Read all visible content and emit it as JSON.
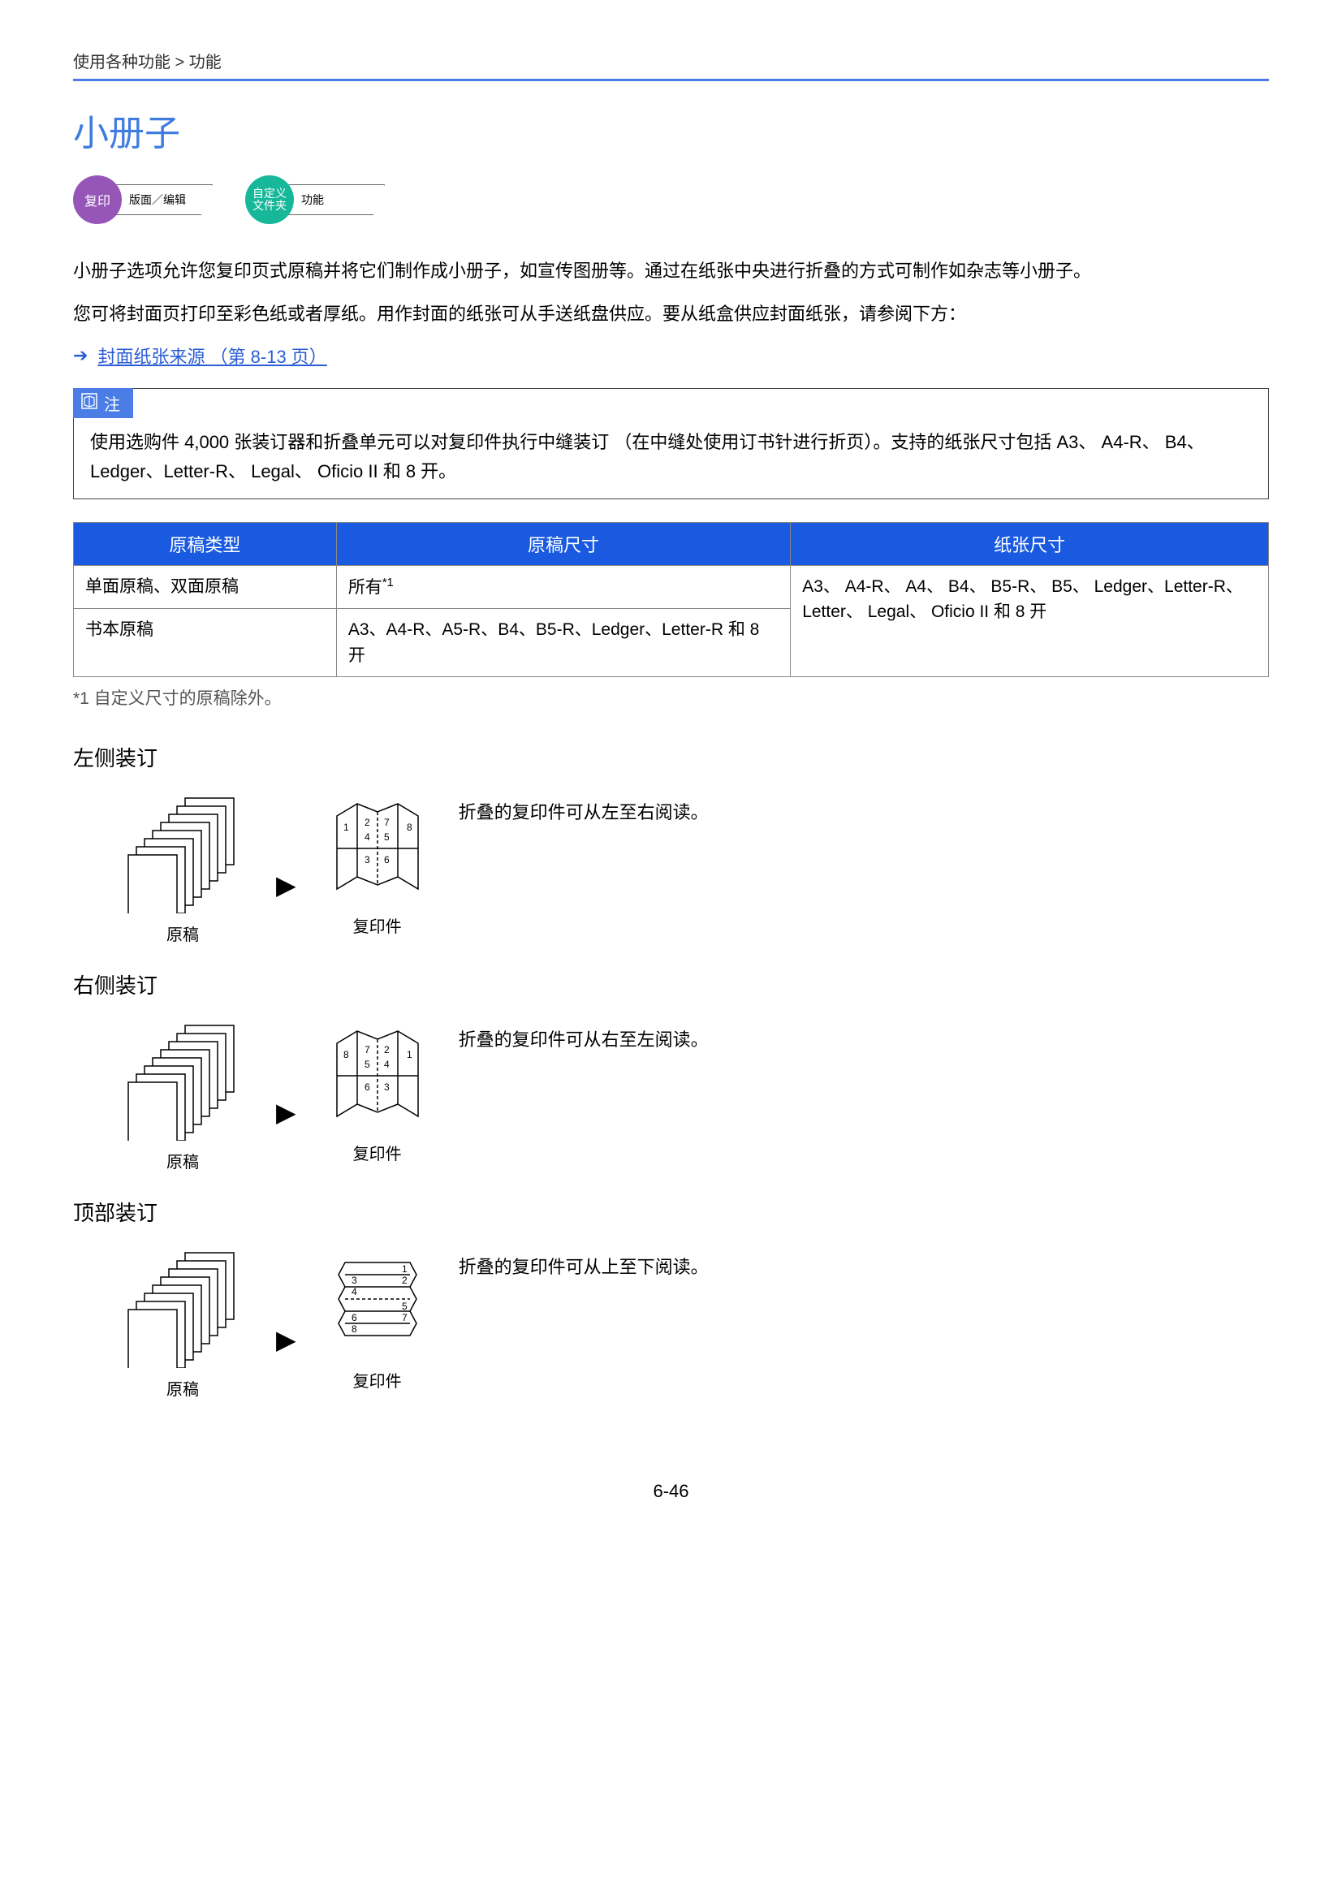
{
  "breadcrumb": "使用各种功能 > 功能",
  "title": "小册子",
  "badges": {
    "copy_circle": "复印",
    "copy_tab": "版面／编辑",
    "custom_circle": "自定义\n文件夹",
    "custom_tab": "功能"
  },
  "paragraphs": {
    "p1": "小册子选项允许您复印页式原稿并将它们制作成小册子，如宣传图册等。通过在纸张中央进行折叠的方式可制作如杂志等小册子。",
    "p2": "您可将封面页打印至彩色纸或者厚纸。用作封面的纸张可从手送纸盘供应。要从纸盒供应封面纸张，请参阅下方："
  },
  "link": "封面纸张来源 （第 8-13 页）",
  "note": {
    "label": "注",
    "body": "使用选购件 4,000 张装订器和折叠单元可以对复印件执行中缝装订 （在中缝处使用订书针进行折页）。支持的纸张尺寸包括 A3、 A4-R、 B4、 Ledger、Letter-R、 Legal、 Oficio II 和 8 开。"
  },
  "table": {
    "headers": {
      "c1": "原稿类型",
      "c2": "原稿尺寸",
      "c3": "纸张尺寸"
    },
    "row1": {
      "c1": "单面原稿、双面原稿",
      "c2_prefix": "所有",
      "c2_sup": "*1"
    },
    "row2": {
      "c1": "书本原稿",
      "c2": "A3、A4-R、A5-R、B4、B5-R、Ledger、Letter-R 和 8 开"
    },
    "c3": "A3、 A4-R、 A4、 B4、 B5-R、 B5、 Ledger、Letter-R、 Letter、 Legal、 Oficio II 和 8 开"
  },
  "footnote": "*1   自定义尺寸的原稿除外。",
  "sections": {
    "left": {
      "h": "左侧装订",
      "orig": "原稿",
      "copy": "复印件",
      "desc": "折叠的复印件可从左至右阅读。"
    },
    "right": {
      "h": "右侧装订",
      "orig": "原稿",
      "copy": "复印件",
      "desc": "折叠的复印件可从右至左阅读。"
    },
    "top": {
      "h": "顶部装订",
      "orig": "原稿",
      "copy": "复印件",
      "desc": "折叠的复印件可从上至下阅读。"
    }
  },
  "page_num": "6-46"
}
